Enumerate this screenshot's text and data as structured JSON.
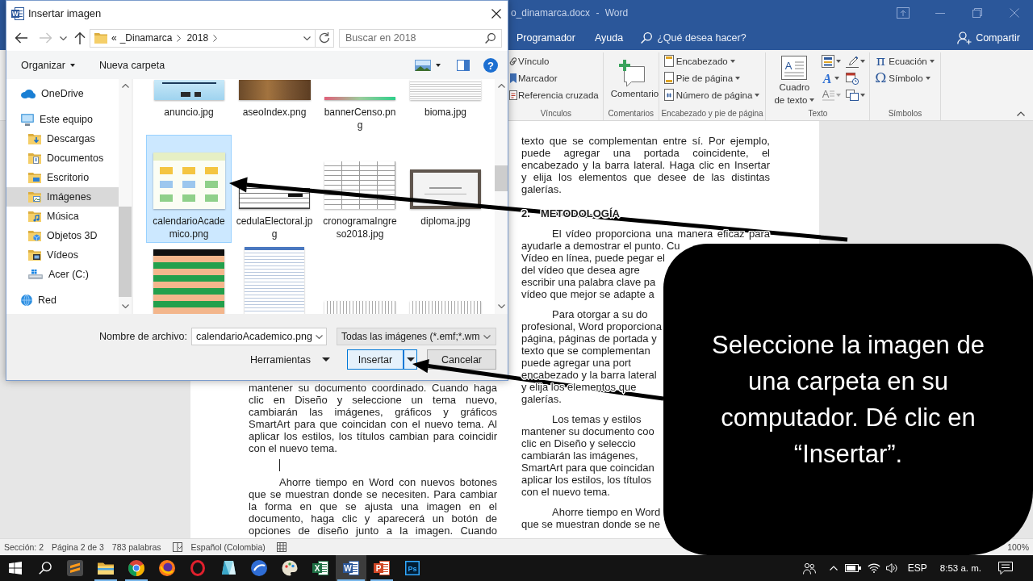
{
  "word": {
    "title": "o_dinamarca.docx - Word",
    "tabs": [
      {
        "label": "Programador",
        "selected": false
      },
      {
        "label": "Ayuda",
        "selected": false
      }
    ],
    "tell_me": {
      "placeholder": "¿Qué desea hacer?"
    },
    "share": {
      "label": "Compartir"
    },
    "ribbon": [
      {
        "label": "Vínculos",
        "items": [
          {
            "kind": "small",
            "label": "Vínculo",
            "dropdown": false,
            "disabled": false
          },
          {
            "kind": "small",
            "label": "Marcador",
            "dropdown": false,
            "disabled": false
          },
          {
            "kind": "small",
            "label": "Referencia cruzada",
            "dropdown": false,
            "disabled": false
          }
        ]
      },
      {
        "label": "Comentarios",
        "items": [
          {
            "kind": "large",
            "label": "Comentario",
            "dropdown": false,
            "disabled": false
          }
        ]
      },
      {
        "label": "Encabezado y pie de página",
        "items": [
          {
            "kind": "small",
            "label": "Encabezado",
            "dropdown": true,
            "disabled": false
          },
          {
            "kind": "small",
            "label": "Pie de página",
            "dropdown": true,
            "disabled": false
          },
          {
            "kind": "small",
            "label": "Número de página",
            "dropdown": true,
            "disabled": false
          }
        ]
      },
      {
        "label": "Texto",
        "items": [
          {
            "kind": "large",
            "label": "Cuadro de texto",
            "glyph": "A",
            "dropdown": true,
            "disabled": false
          },
          {
            "kind": "icon",
            "dropdown": true,
            "disabled": false
          },
          {
            "kind": "icon",
            "glyph": "A",
            "dropdown": true,
            "disabled": false
          },
          {
            "kind": "icon",
            "glyph": "A",
            "dropdown": true,
            "disabled": true
          },
          {
            "kind": "icon",
            "dropdown": true,
            "disabled": false
          },
          {
            "kind": "icon",
            "dropdown": false,
            "disabled": false
          },
          {
            "kind": "icon",
            "dropdown": true,
            "disabled": false
          }
        ]
      },
      {
        "label": "Símbolos",
        "items": [
          {
            "kind": "small",
            "label": "Ecuación",
            "glyph": "π",
            "dropdown": true,
            "disabled": false
          },
          {
            "kind": "small",
            "label": "Símbolo",
            "glyph": "Ω",
            "dropdown": true,
            "disabled": false
          }
        ]
      }
    ],
    "page": {
      "columns": [
        {
          "paragraphs": [
            {
              "kind": "body",
              "continued": true,
              "caret": false,
              "lines": [
                "mantener su documento coordinado. Cuando haga",
                "clic en Diseño y seleccione un tema nuevo,",
                "cambiarán las imágenes, gráficos y gráficos",
                "SmartArt para que coincidan con el nuevo tema. Al",
                "aplicar los estilos, los títulos cambian para coincidir",
                "con el nuevo tema."
              ]
            },
            {
              "kind": "empty",
              "caret": true
            },
            {
              "kind": "body",
              "continued": false,
              "caret": false,
              "lines": [
                "Ahorre tiempo en Word con nuevos botones",
                "que se muestran donde se necesiten. Para cambiar",
                "la forma en que se ajusta una imagen en el",
                "documento, haga clic y aparecerá un botón de",
                "opciones de diseño junto a la imagen. Cuando"
              ]
            }
          ]
        },
        {
          "paragraphs": [
            {
              "kind": "body",
              "continued": true,
              "caret": false,
              "lines": [
                "texto que se complementan entre sí. Por ejemplo,",
                "puede agregar una portada coincidente, el",
                "encabezado y la barra lateral. Haga clic en Insertar",
                "y elija los elementos que desee de las distintas",
                "galerías."
              ]
            },
            {
              "kind": "heading",
              "number": "2.",
              "text": "METODOLOGÍA",
              "caret": false
            },
            {
              "kind": "fragment",
              "continued": false,
              "caret": false,
              "lines": [
                "El vídeo proporciona una manera eficaz para",
                "ayudarle a demostrar el punto. Cu",
                "Vídeo en línea, puede pegar el",
                "del vídeo que desea agre",
                "escribir una palabra clave pa",
                "vídeo que mejor se adapte a"
              ]
            },
            {
              "kind": "fragment",
              "continued": false,
              "caret": false,
              "lines": [
                "Para otorgar a su do",
                "profesional, Word proporciona",
                "página, páginas de portada y",
                "texto que se complementan",
                "puede agregar una port",
                "encabezado y la barra lateral",
                "y elija los elementos que",
                "galerías."
              ]
            },
            {
              "kind": "fragment",
              "continued": false,
              "caret": false,
              "lines": [
                "Los temas y estilos",
                "mantener su documento coo",
                "clic en Diseño y seleccio",
                "cambiarán las imágenes,",
                "SmartArt para que coincidan",
                "aplicar los estilos, los títulos",
                "con el nuevo tema."
              ]
            },
            {
              "kind": "fragment",
              "continued": false,
              "caret": false,
              "lines": [
                "Ahorre tiempo en Word",
                "que se muestran donde se ne"
              ]
            }
          ]
        }
      ]
    },
    "status_bar": {
      "section": "Sección: 2",
      "page": "Página 2 de 3",
      "words": "783 palabras",
      "language": "Español (Colombia)",
      "zoom": "100%"
    }
  },
  "dialog": {
    "title": "Insertar imagen",
    "app_glyph": "W",
    "history": [
      {
        "kind": "back",
        "disabled": false
      },
      {
        "kind": "forward",
        "disabled": true
      }
    ],
    "address": {
      "overflow": "«",
      "path": [
        "_Dinamarca",
        "2018"
      ]
    },
    "search": {
      "placeholder": "Buscar en 2018"
    },
    "toolbar": {
      "organize": "Organizar",
      "new_folder": "Nueva carpeta",
      "help_glyph": "?"
    },
    "nav": [
      {
        "label": "OneDrive",
        "selected": false
      },
      {
        "label": "Este equipo",
        "selected": false,
        "children": [
          {
            "label": "Descargas",
            "selected": false
          },
          {
            "label": "Documentos",
            "selected": false
          },
          {
            "label": "Escritorio",
            "selected": false
          },
          {
            "label": "Imágenes",
            "selected": true
          },
          {
            "label": "Música",
            "selected": false
          },
          {
            "label": "Objetos 3D",
            "selected": false
          },
          {
            "label": "Vídeos",
            "selected": false
          },
          {
            "label": "Acer (C:)",
            "selected": false
          }
        ]
      },
      {
        "label": "Red",
        "selected": false
      }
    ],
    "files": [
      {
        "name": "anuncio.jpg",
        "kind": "flyer",
        "selected": false
      },
      {
        "name": "aseoIndex.png",
        "kind": "photo",
        "selected": false
      },
      {
        "name": "bannerCenso.png",
        "kind": "banner",
        "selected": false
      },
      {
        "name": "bioma.jpg",
        "kind": "document",
        "selected": false
      },
      {
        "name": "calendarioAcademico.png",
        "kind": "calendar",
        "selected": true
      },
      {
        "name": "cedulaElectoral.jpg",
        "kind": "card",
        "selected": false
      },
      {
        "name": "cronogramaIngreso2018.jpg",
        "kind": "schedule",
        "selected": false
      },
      {
        "name": "diploma.jpg",
        "kind": "certificate",
        "selected": false
      },
      {
        "kind": "green-table",
        "selected": false
      },
      {
        "kind": "list",
        "selected": false
      },
      {
        "kind": "wide-table",
        "selected": false
      },
      {
        "kind": "wide-table",
        "selected": false
      }
    ],
    "filename": {
      "label": "Nombre de archivo:",
      "value": "calendarioAcademico.png"
    },
    "file_type": "Todas las imágenes (*.emf;*.wm",
    "tools": "Herramientas",
    "buttons": [
      {
        "label": "Insertar",
        "kind": "split",
        "default": true
      },
      {
        "label": "Cancelar",
        "kind": "plain",
        "default": false
      }
    ]
  },
  "callout": {
    "text": "Seleccione la imagen de una carpeta en su computador. Dé clic en “Insertar”."
  },
  "taskbar": {
    "apps": [
      {
        "kind": "editor",
        "running": false,
        "selected": false
      },
      {
        "kind": "folder",
        "running": true,
        "selected": false
      },
      {
        "kind": "wheel",
        "running": true,
        "selected": false
      },
      {
        "kind": "orb",
        "running": false,
        "selected": false
      },
      {
        "kind": "ring",
        "running": false,
        "selected": false
      },
      {
        "kind": "prism",
        "running": false,
        "selected": false
      },
      {
        "kind": "disc",
        "running": false,
        "selected": false
      },
      {
        "kind": "palette",
        "running": false,
        "selected": false
      },
      {
        "kind": "spreadsheet",
        "glyph": "X",
        "running": false,
        "selected": false
      },
      {
        "kind": "document",
        "glyph": "W",
        "running": true,
        "selected": true
      },
      {
        "kind": "presentation",
        "glyph": "P",
        "running": true,
        "selected": false
      },
      {
        "kind": "image-editor",
        "glyph": "Ps",
        "running": false,
        "selected": false
      }
    ],
    "language": "ESP",
    "time": "8:53 a. m."
  }
}
